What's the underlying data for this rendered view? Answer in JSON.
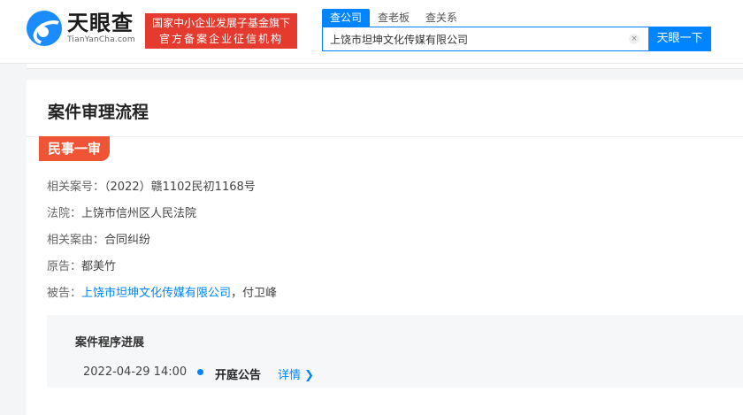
{
  "header": {
    "logo_cn": "天眼查",
    "logo_en": "TianYanCha.com",
    "gov_line1": "国家中小企业发展子基金旗下",
    "gov_line2": "官方备案企业征信机构",
    "tabs": [
      {
        "label": "查公司",
        "active": true
      },
      {
        "label": "查老板",
        "active": false
      },
      {
        "label": "查关系",
        "active": false
      }
    ],
    "search_value": "上饶市坦坤文化传媒有限公司",
    "clear_glyph": "×",
    "search_button": "天眼一下"
  },
  "card": {
    "title": "案件审理流程",
    "stage": "民事一审",
    "rows": {
      "case_no": {
        "label": "相关案号：",
        "value": "（2022）赣1102民初1168号"
      },
      "court": {
        "label": "法院：",
        "value": "上饶市信州区人民法院"
      },
      "cause": {
        "label": "相关案由：",
        "value": "合同纠纷"
      },
      "plaintiff": {
        "label": "原告：",
        "value": "都美竹"
      },
      "defendant": {
        "label": "被告：",
        "link": "上饶市坦坤文化传媒有限公司",
        "sep": "，",
        "value": "付卫峰"
      }
    },
    "progress": {
      "title": "案件程序进展",
      "items": [
        {
          "date": "2022-04-29 14:00",
          "event": "开庭公告",
          "link": "详情 ❯"
        }
      ]
    }
  },
  "colors": {
    "brand_blue": "#0084ff",
    "stage_red": "#ef5434",
    "badge_red": "#e53b2f"
  }
}
